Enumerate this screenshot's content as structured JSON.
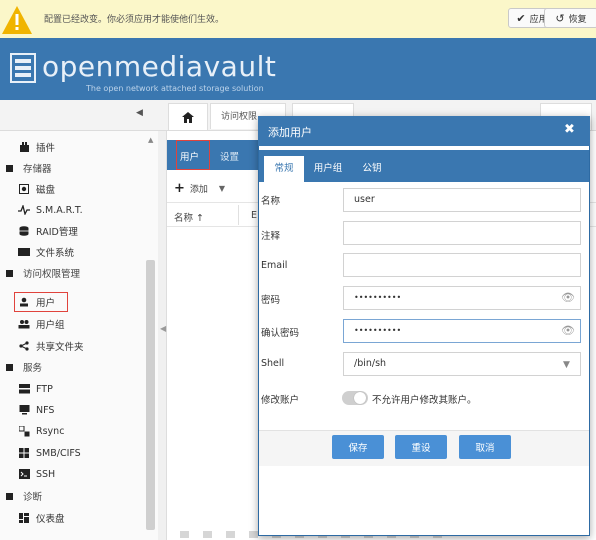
{
  "warning": {
    "message": "配置已经改变。你必须应用才能使他们生效。",
    "apply_label": "应用",
    "revert_label": "恢复"
  },
  "brand": {
    "name": "openmediavault",
    "tagline": "The open network attached storage solution"
  },
  "breadcrumb": {
    "current": "访问权限"
  },
  "sidebar": {
    "items": [
      {
        "label": "插件",
        "icon": "plugin-icon",
        "level": 1
      },
      {
        "label": "存储器",
        "icon": "category-icon",
        "level": 0
      },
      {
        "label": "磁盘",
        "icon": "disk-icon",
        "level": 1
      },
      {
        "label": "S.M.A.R.T.",
        "icon": "pulse-icon",
        "level": 1
      },
      {
        "label": "RAID管理",
        "icon": "database-icon",
        "level": 1
      },
      {
        "label": "文件系统",
        "icon": "folder-icon",
        "level": 1
      },
      {
        "label": "访问权限管理",
        "icon": "category-icon",
        "level": 0
      },
      {
        "label": "用户",
        "icon": "user-icon",
        "level": 1
      },
      {
        "label": "用户组",
        "icon": "users-icon",
        "level": 1
      },
      {
        "label": "共享文件夹",
        "icon": "share-icon",
        "level": 1
      },
      {
        "label": "服务",
        "icon": "category-icon",
        "level": 0
      },
      {
        "label": "FTP",
        "icon": "server-icon",
        "level": 1
      },
      {
        "label": "NFS",
        "icon": "monitor-icon",
        "level": 1
      },
      {
        "label": "Rsync",
        "icon": "rsync-icon",
        "level": 1
      },
      {
        "label": "SMB/CIFS",
        "icon": "windows-icon",
        "level": 1
      },
      {
        "label": "SSH",
        "icon": "terminal-icon",
        "level": 1
      },
      {
        "label": "诊断",
        "icon": "category-icon",
        "level": 0
      },
      {
        "label": "仪表盘",
        "icon": "dashboard-icon",
        "level": 1
      }
    ]
  },
  "main": {
    "tabs": [
      {
        "label": "用户"
      },
      {
        "label": "设置"
      }
    ],
    "add_label": "添加",
    "columns": [
      "名称 ↑",
      "E"
    ]
  },
  "dialog": {
    "title": "添加用户",
    "close_glyph": "✖",
    "tabs": [
      "常规",
      "用户组",
      "公钥"
    ],
    "fields": {
      "name": {
        "label": "名称",
        "value": "user"
      },
      "comment": {
        "label": "注释",
        "value": ""
      },
      "email": {
        "label": "Email",
        "value": ""
      },
      "password": {
        "label": "密码",
        "value": "••••••••••"
      },
      "confirm_password": {
        "label": "确认密码",
        "value": "••••••••••"
      },
      "shell": {
        "label": "Shell",
        "value": "/bin/sh"
      },
      "modify_account": {
        "label": "修改账户",
        "toggle_text": "不允许用户修改其账户。",
        "enabled": false
      }
    },
    "buttons": {
      "save": "保存",
      "reset": "重设",
      "cancel": "取消"
    }
  },
  "colors": {
    "header_blue": "#3a77b0",
    "button_blue": "#4a90d6",
    "highlight_red": "#e0433c",
    "warning_bg": "#fbf7c9"
  }
}
